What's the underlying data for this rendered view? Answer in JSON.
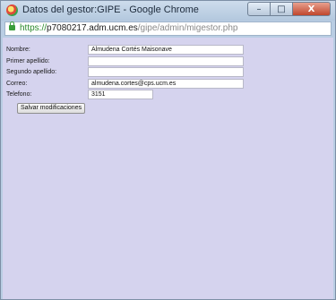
{
  "window": {
    "title": "Datos del gestor:GIPE - Google Chrome",
    "buttons": {
      "minimize": "–",
      "maximize": "□",
      "close": "X"
    }
  },
  "address_bar": {
    "protocol": "https://",
    "host": "p7080217.adm.ucm.es",
    "path": "/gipe/admin/migestor.php"
  },
  "form": {
    "fields": [
      {
        "label": "Nombre:",
        "value": "Almudena Cortés Maisonave"
      },
      {
        "label": "Primer apellido:",
        "value": ""
      },
      {
        "label": "Segundo apellido:",
        "value": ""
      },
      {
        "label": "Correo:",
        "value": "almudena.cortes@cps.ucm.es"
      },
      {
        "label": "Telefono:",
        "value": "3151"
      }
    ],
    "save_label": "Salvar modificaciones"
  }
}
